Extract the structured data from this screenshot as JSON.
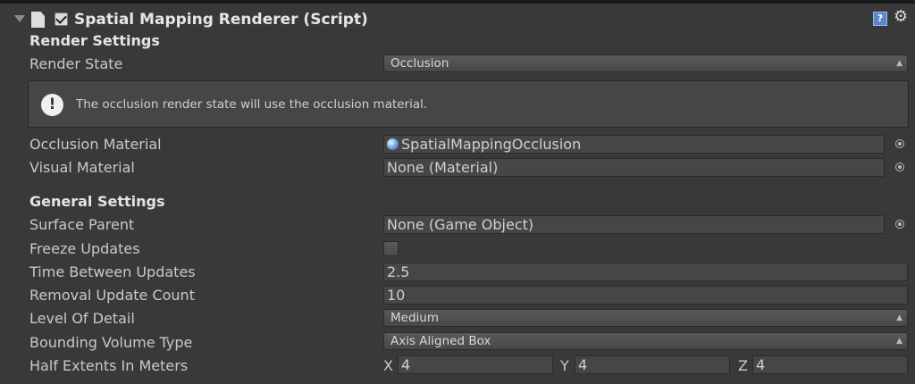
{
  "header": {
    "title": "Spatial Mapping Renderer (Script)",
    "enabled": true,
    "icons": [
      "foldout-arrow-icon",
      "script-icon",
      "help-icon",
      "gear-icon"
    ]
  },
  "render_settings": {
    "heading": "Render Settings",
    "render_state": {
      "label": "Render State",
      "value": "Occlusion"
    },
    "help_message": "The occlusion render state will use the occlusion material.",
    "occlusion_material": {
      "label": "Occlusion Material",
      "value": "SpatialMappingOcclusion"
    },
    "visual_material": {
      "label": "Visual Material",
      "value": "None (Material)"
    }
  },
  "general_settings": {
    "heading": "General Settings",
    "surface_parent": {
      "label": "Surface Parent",
      "value": "None (Game Object)"
    },
    "freeze_updates": {
      "label": "Freeze Updates",
      "checked": false
    },
    "time_between_updates": {
      "label": "Time Between Updates",
      "value": "2.5"
    },
    "removal_update_count": {
      "label": "Removal Update Count",
      "value": "10"
    },
    "level_of_detail": {
      "label": "Level Of Detail",
      "value": "Medium"
    },
    "bounding_volume_type": {
      "label": "Bounding Volume Type",
      "value": "Axis Aligned Box"
    },
    "half_extents": {
      "label": "Half Extents In Meters",
      "x_label": "X",
      "x": "4",
      "y_label": "Y",
      "y": "4",
      "z_label": "Z",
      "z": "4"
    }
  }
}
